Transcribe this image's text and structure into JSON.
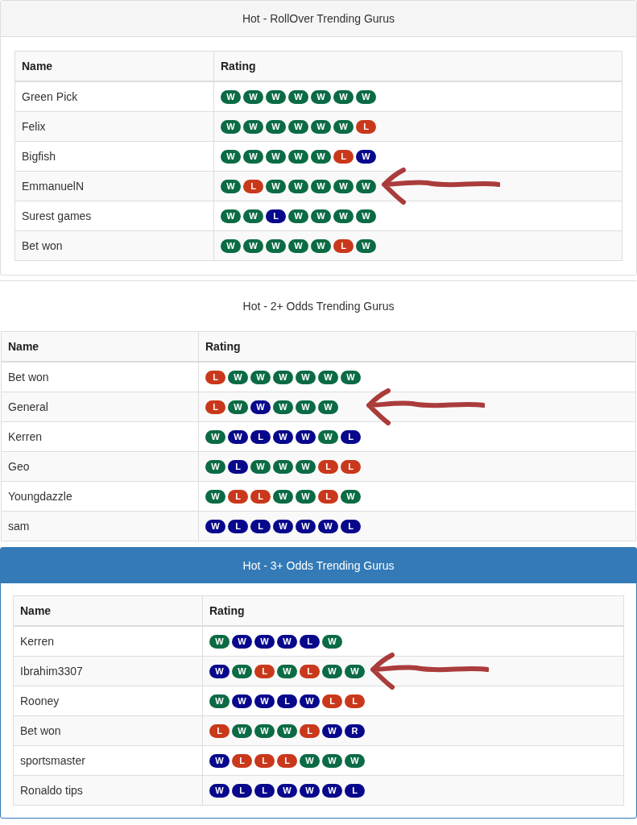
{
  "panels": [
    {
      "kind": "default",
      "title": "Hot - RollOver Trending Gurus",
      "columns": [
        "Name",
        "Rating"
      ],
      "rows": [
        {
          "name": "Green Pick",
          "marked": false,
          "badges": [
            {
              "label": "W",
              "color": "#0b6b44"
            },
            {
              "label": "W",
              "color": "#0b6b44"
            },
            {
              "label": "W",
              "color": "#0b6b44"
            },
            {
              "label": "W",
              "color": "#0b6b44"
            },
            {
              "label": "W",
              "color": "#0b6b44"
            },
            {
              "label": "W",
              "color": "#0b6b44"
            },
            {
              "label": "W",
              "color": "#0b6b44"
            }
          ]
        },
        {
          "name": "Felix",
          "marked": false,
          "badges": [
            {
              "label": "W",
              "color": "#0b6b44"
            },
            {
              "label": "W",
              "color": "#0b6b44"
            },
            {
              "label": "W",
              "color": "#0b6b44"
            },
            {
              "label": "W",
              "color": "#0b6b44"
            },
            {
              "label": "W",
              "color": "#0b6b44"
            },
            {
              "label": "W",
              "color": "#0b6b44"
            },
            {
              "label": "L",
              "color": "#c9381b"
            }
          ]
        },
        {
          "name": "Bigfish",
          "marked": false,
          "badges": [
            {
              "label": "W",
              "color": "#0b6b44"
            },
            {
              "label": "W",
              "color": "#0b6b44"
            },
            {
              "label": "W",
              "color": "#0b6b44"
            },
            {
              "label": "W",
              "color": "#0b6b44"
            },
            {
              "label": "W",
              "color": "#0b6b44"
            },
            {
              "label": "L",
              "color": "#c9381b"
            },
            {
              "label": "W",
              "color": "#08088c"
            }
          ]
        },
        {
          "name": "EmmanuelN",
          "marked": true,
          "badges": [
            {
              "label": "W",
              "color": "#0b6b44"
            },
            {
              "label": "L",
              "color": "#c9381b"
            },
            {
              "label": "W",
              "color": "#0b6b44"
            },
            {
              "label": "W",
              "color": "#0b6b44"
            },
            {
              "label": "W",
              "color": "#0b6b44"
            },
            {
              "label": "W",
              "color": "#0b6b44"
            },
            {
              "label": "W",
              "color": "#0b6b44"
            }
          ]
        },
        {
          "name": "Surest games",
          "marked": false,
          "badges": [
            {
              "label": "W",
              "color": "#0b6b44"
            },
            {
              "label": "W",
              "color": "#0b6b44"
            },
            {
              "label": "L",
              "color": "#08088c"
            },
            {
              "label": "W",
              "color": "#0b6b44"
            },
            {
              "label": "W",
              "color": "#0b6b44"
            },
            {
              "label": "W",
              "color": "#0b6b44"
            },
            {
              "label": "W",
              "color": "#0b6b44"
            }
          ]
        },
        {
          "name": "Bet won",
          "marked": false,
          "badges": [
            {
              "label": "W",
              "color": "#0b6b44"
            },
            {
              "label": "W",
              "color": "#0b6b44"
            },
            {
              "label": "W",
              "color": "#0b6b44"
            },
            {
              "label": "W",
              "color": "#0b6b44"
            },
            {
              "label": "W",
              "color": "#0b6b44"
            },
            {
              "label": "L",
              "color": "#c9381b"
            },
            {
              "label": "W",
              "color": "#0b6b44"
            }
          ]
        }
      ]
    },
    {
      "kind": "plain",
      "title": "Hot - 2+ Odds Trending Gurus",
      "columns": [
        "Name",
        "Rating"
      ],
      "rows": [
        {
          "name": "Bet won",
          "marked": false,
          "badges": [
            {
              "label": "L",
              "color": "#c9381b"
            },
            {
              "label": "W",
              "color": "#0b6b44"
            },
            {
              "label": "W",
              "color": "#0b6b44"
            },
            {
              "label": "W",
              "color": "#0b6b44"
            },
            {
              "label": "W",
              "color": "#0b6b44"
            },
            {
              "label": "W",
              "color": "#0b6b44"
            },
            {
              "label": "W",
              "color": "#0b6b44"
            }
          ]
        },
        {
          "name": "General",
          "marked": true,
          "badges": [
            {
              "label": "L",
              "color": "#c9381b"
            },
            {
              "label": "W",
              "color": "#0b6b44"
            },
            {
              "label": "W",
              "color": "#08088c"
            },
            {
              "label": "W",
              "color": "#0b6b44"
            },
            {
              "label": "W",
              "color": "#0b6b44"
            },
            {
              "label": "W",
              "color": "#0b6b44"
            }
          ]
        },
        {
          "name": "Kerren",
          "marked": false,
          "badges": [
            {
              "label": "W",
              "color": "#0b6b44"
            },
            {
              "label": "W",
              "color": "#08088c"
            },
            {
              "label": "L",
              "color": "#08088c"
            },
            {
              "label": "W",
              "color": "#08088c"
            },
            {
              "label": "W",
              "color": "#08088c"
            },
            {
              "label": "W",
              "color": "#0b6b44"
            },
            {
              "label": "L",
              "color": "#08088c"
            }
          ]
        },
        {
          "name": "Geo",
          "marked": false,
          "badges": [
            {
              "label": "W",
              "color": "#0b6b44"
            },
            {
              "label": "L",
              "color": "#08088c"
            },
            {
              "label": "W",
              "color": "#0b6b44"
            },
            {
              "label": "W",
              "color": "#0b6b44"
            },
            {
              "label": "W",
              "color": "#0b6b44"
            },
            {
              "label": "L",
              "color": "#c9381b"
            },
            {
              "label": "L",
              "color": "#c9381b"
            }
          ]
        },
        {
          "name": "Youngdazzle",
          "marked": false,
          "badges": [
            {
              "label": "W",
              "color": "#0b6b44"
            },
            {
              "label": "L",
              "color": "#c9381b"
            },
            {
              "label": "L",
              "color": "#c9381b"
            },
            {
              "label": "W",
              "color": "#0b6b44"
            },
            {
              "label": "W",
              "color": "#0b6b44"
            },
            {
              "label": "L",
              "color": "#c9381b"
            },
            {
              "label": "W",
              "color": "#0b6b44"
            }
          ]
        },
        {
          "name": "sam",
          "marked": false,
          "badges": [
            {
              "label": "W",
              "color": "#08088c"
            },
            {
              "label": "L",
              "color": "#08088c"
            },
            {
              "label": "L",
              "color": "#08088c"
            },
            {
              "label": "W",
              "color": "#08088c"
            },
            {
              "label": "W",
              "color": "#08088c"
            },
            {
              "label": "W",
              "color": "#08088c"
            },
            {
              "label": "L",
              "color": "#08088c"
            }
          ]
        }
      ]
    },
    {
      "kind": "primary",
      "title": "Hot - 3+ Odds Trending Gurus",
      "columns": [
        "Name",
        "Rating"
      ],
      "rows": [
        {
          "name": "Kerren",
          "marked": false,
          "badges": [
            {
              "label": "W",
              "color": "#0b6b44"
            },
            {
              "label": "W",
              "color": "#08088c"
            },
            {
              "label": "W",
              "color": "#08088c"
            },
            {
              "label": "W",
              "color": "#08088c"
            },
            {
              "label": "L",
              "color": "#08088c"
            },
            {
              "label": "W",
              "color": "#0b6b44"
            }
          ]
        },
        {
          "name": "Ibrahim3307",
          "marked": true,
          "badges": [
            {
              "label": "W",
              "color": "#08088c"
            },
            {
              "label": "W",
              "color": "#0b6b44"
            },
            {
              "label": "L",
              "color": "#c9381b"
            },
            {
              "label": "W",
              "color": "#0b6b44"
            },
            {
              "label": "L",
              "color": "#c9381b"
            },
            {
              "label": "W",
              "color": "#0b6b44"
            },
            {
              "label": "W",
              "color": "#0b6b44"
            }
          ]
        },
        {
          "name": "Rooney",
          "marked": false,
          "badges": [
            {
              "label": "W",
              "color": "#0b6b44"
            },
            {
              "label": "W",
              "color": "#08088c"
            },
            {
              "label": "W",
              "color": "#08088c"
            },
            {
              "label": "L",
              "color": "#08088c"
            },
            {
              "label": "W",
              "color": "#08088c"
            },
            {
              "label": "L",
              "color": "#c9381b"
            },
            {
              "label": "L",
              "color": "#c9381b"
            }
          ]
        },
        {
          "name": "Bet won",
          "marked": false,
          "badges": [
            {
              "label": "L",
              "color": "#c9381b"
            },
            {
              "label": "W",
              "color": "#0b6b44"
            },
            {
              "label": "W",
              "color": "#0b6b44"
            },
            {
              "label": "W",
              "color": "#0b6b44"
            },
            {
              "label": "L",
              "color": "#c9381b"
            },
            {
              "label": "W",
              "color": "#08088c"
            },
            {
              "label": "R",
              "color": "#08088c"
            }
          ]
        },
        {
          "name": "sportsmaster",
          "marked": false,
          "badges": [
            {
              "label": "W",
              "color": "#08088c"
            },
            {
              "label": "L",
              "color": "#c9381b"
            },
            {
              "label": "L",
              "color": "#c9381b"
            },
            {
              "label": "L",
              "color": "#c9381b"
            },
            {
              "label": "W",
              "color": "#0b6b44"
            },
            {
              "label": "W",
              "color": "#0b6b44"
            },
            {
              "label": "W",
              "color": "#0b6b44"
            }
          ]
        },
        {
          "name": "Ronaldo tips",
          "marked": false,
          "badges": [
            {
              "label": "W",
              "color": "#08088c"
            },
            {
              "label": "L",
              "color": "#08088c"
            },
            {
              "label": "L",
              "color": "#08088c"
            },
            {
              "label": "W",
              "color": "#08088c"
            },
            {
              "label": "W",
              "color": "#08088c"
            },
            {
              "label": "W",
              "color": "#08088c"
            },
            {
              "label": "L",
              "color": "#08088c"
            }
          ]
        }
      ]
    }
  ]
}
